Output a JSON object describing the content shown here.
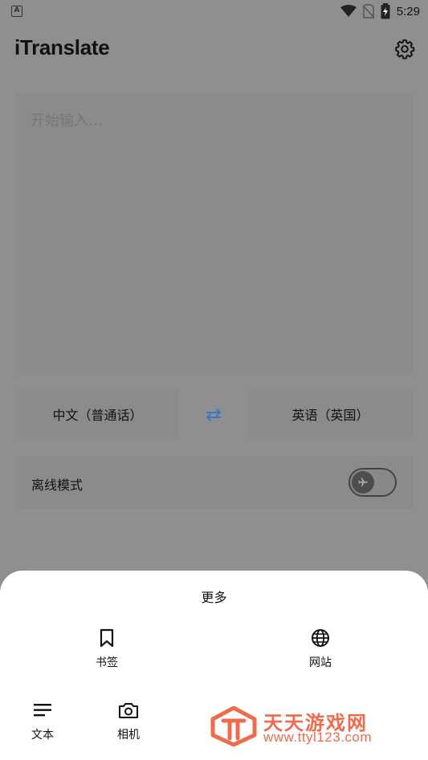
{
  "status_bar": {
    "left_icon_letter": "A",
    "time": "5:29"
  },
  "app": {
    "title": "iTranslate"
  },
  "input": {
    "placeholder": "开始输入…",
    "value": ""
  },
  "languages": {
    "source": "中文（普通话）",
    "target": "英语（英国）"
  },
  "offline": {
    "label": "离线模式",
    "enabled": false
  },
  "sheet": {
    "title": "更多",
    "items": [
      {
        "label": "书签",
        "icon": "bookmark-icon"
      },
      {
        "label": "网站",
        "icon": "globe-icon"
      },
      {
        "label": "文本",
        "icon": "text-lines-icon"
      },
      {
        "label": "相机",
        "icon": "camera-icon"
      }
    ]
  },
  "watermark": {
    "name": "天天游戏网",
    "url": "www.ttyl123.com"
  },
  "colors": {
    "scrim": "#8f8f8f",
    "accent": "#3a78c4",
    "watermark": "#ee6b4d"
  }
}
